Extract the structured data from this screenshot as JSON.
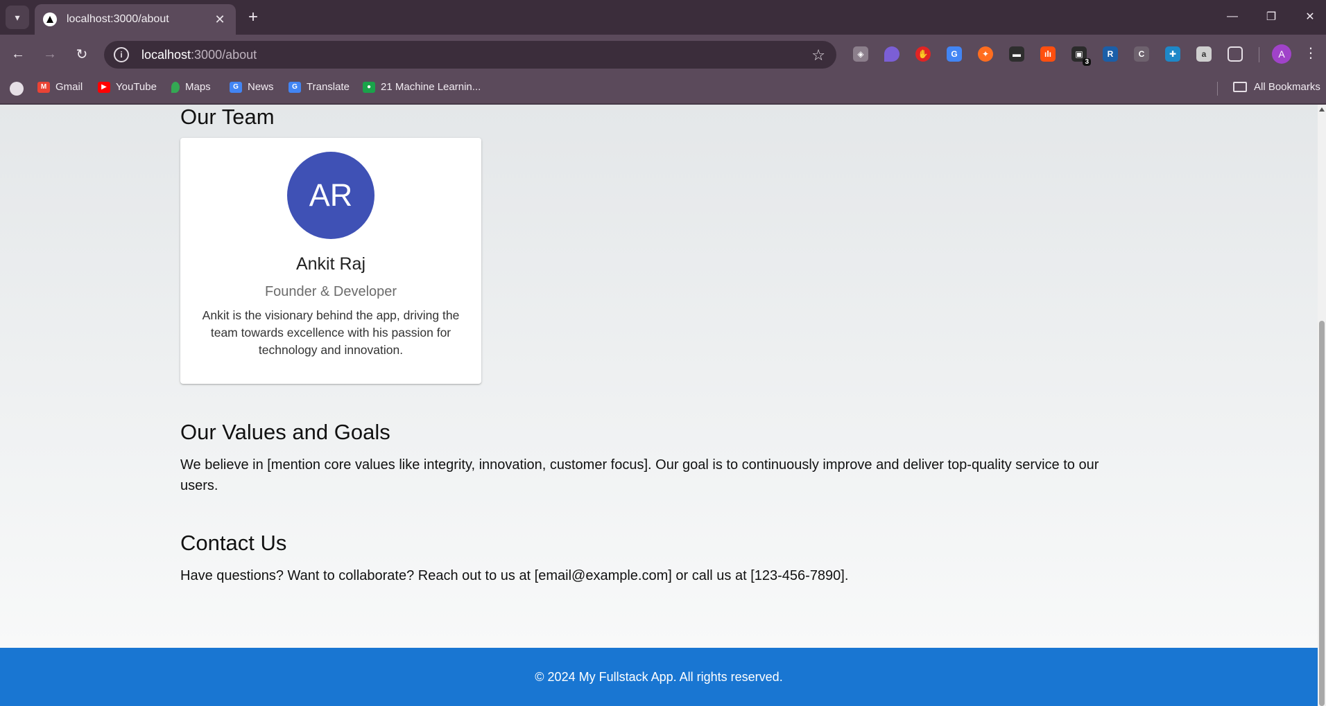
{
  "browser": {
    "tab_title": "localhost:3000/about",
    "url_host": "localhost",
    "url_path": ":3000/about",
    "bookmarks": [
      {
        "label": "Gmail"
      },
      {
        "label": "YouTube"
      },
      {
        "label": "Maps"
      },
      {
        "label": "News"
      },
      {
        "label": "Translate"
      },
      {
        "label": "21 Machine Learnin..."
      }
    ],
    "all_bookmarks_label": "All Bookmarks",
    "profile_initial": "A",
    "extension_badge": "3"
  },
  "page": {
    "team_heading": "Our Team",
    "member": {
      "initials": "AR",
      "name": "Ankit Raj",
      "role": "Founder & Developer",
      "bio": "Ankit is the visionary behind the app, driving the team towards excellence with his passion for technology and innovation.",
      "avatar_color": "#3f51b5"
    },
    "values_heading": "Our Values and Goals",
    "values_text": "We believe in [mention core values like integrity, innovation, customer focus]. Our goal is to continuously improve and deliver top-quality service to our users.",
    "contact_heading": "Contact Us",
    "contact_text": "Have questions? Want to collaborate? Reach out to us at [email@example.com] or call us at [123-456-7890].",
    "footer_text": "© 2024 My Fullstack App. All rights reserved.",
    "footer_color": "#1976d2"
  }
}
